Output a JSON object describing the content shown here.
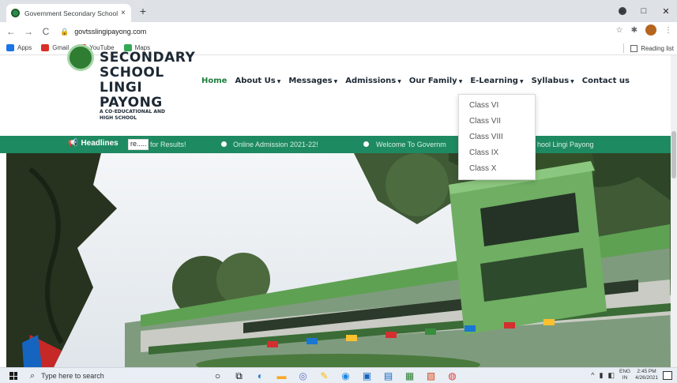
{
  "browser": {
    "tab_title": "Government Secondary School L",
    "tab_close": "×",
    "new_tab": "+",
    "url": "govtsslingipayong.com",
    "back": "←",
    "forward": "→",
    "reload": "C",
    "star": "☆",
    "extensions": "✱",
    "menu": "⋮",
    "window_min": "–",
    "window_max": "□",
    "window_close": "✕",
    "bookmarks": [
      {
        "label": "Apps",
        "icon": "apps-grid-icon",
        "color": "#1a73e8"
      },
      {
        "label": "Gmail",
        "icon": "gmail-icon",
        "color": "#d93025"
      },
      {
        "label": "YouTube",
        "icon": "youtube-icon",
        "color": "#ff0000"
      },
      {
        "label": "Maps",
        "icon": "maps-icon",
        "color": "#34a853"
      }
    ],
    "reading_list": "Reading list"
  },
  "site": {
    "name_lines": [
      "SECONDARY",
      "SCHOOL",
      "LINGI",
      "PAYONG"
    ],
    "tagline_lines": [
      "A CO-EDUCATIONAL AND",
      "HIGH SCHOOL"
    ],
    "nav": [
      {
        "label": "Home",
        "caret": false
      },
      {
        "label": "About Us",
        "caret": true
      },
      {
        "label": "Messages",
        "caret": true
      },
      {
        "label": "Admissions",
        "caret": true
      },
      {
        "label": "Our Family",
        "caret": true
      },
      {
        "label": "E-Learning",
        "caret": true
      },
      {
        "label": "Syllabus",
        "caret": true
      },
      {
        "label": "Contact us",
        "caret": false
      }
    ],
    "accent_color": "#1e8a62",
    "ticker": {
      "label": "Headlines",
      "input_value": "re.....",
      "items": [
        "for Results!",
        "Online Admission 2021-22!",
        "Welcome To Governm",
        "hool Lingi Payong"
      ]
    },
    "elearning_menu": [
      "Class VI",
      "Class VII",
      "Class VIII",
      "Class IX",
      "Class X"
    ]
  },
  "taskbar": {
    "search_placeholder": "Type here to search",
    "lang_top": "ENG",
    "lang_bottom": "IN",
    "time": "2:45 PM",
    "date": "4/26/2021",
    "tray_up": "^"
  }
}
